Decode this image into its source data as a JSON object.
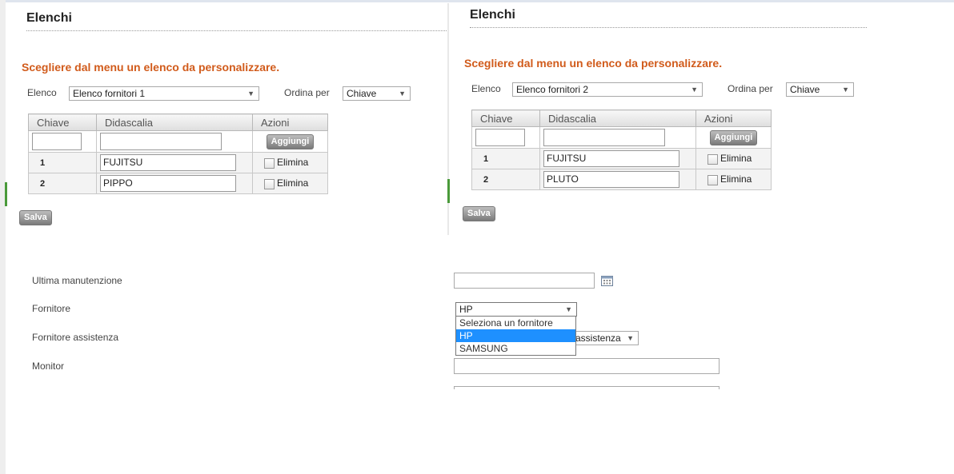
{
  "panel1": {
    "title": "Elenchi",
    "message": "Scegliere dal menu un elenco da personalizzare.",
    "elenco_label": "Elenco",
    "elenco_value": "Elenco fornitori 1",
    "ordina_label": "Ordina per",
    "ordina_value": "Chiave",
    "columns": [
      "Chiave",
      "Didascalia",
      "Azioni"
    ],
    "add_button": "Aggiungi",
    "rows": [
      {
        "key": "1",
        "caption": "FUJITSU",
        "action": "Elimina"
      },
      {
        "key": "2",
        "caption": "PIPPO",
        "action": "Elimina"
      }
    ],
    "save_button": "Salva"
  },
  "panel2": {
    "title": "Elenchi",
    "message": "Scegliere dal menu un elenco da personalizzare.",
    "elenco_label": "Elenco",
    "elenco_value": "Elenco fornitori 2",
    "ordina_label": "Ordina per",
    "ordina_value": "Chiave",
    "columns": [
      "Chiave",
      "Didascalia",
      "Azioni"
    ],
    "add_button": "Aggiungi",
    "rows": [
      {
        "key": "1",
        "caption": "FUJITSU",
        "action": "Elimina"
      },
      {
        "key": "2",
        "caption": "PLUTO",
        "action": "Elimina"
      }
    ],
    "save_button": "Salva"
  },
  "form": {
    "ultima_label": "Ultima manutenzione",
    "fornitore_label": "Fornitore",
    "fornitore_value": "HP",
    "fornitore_options": [
      "Seleziona un fornitore",
      "HP",
      "SAMSUNG"
    ],
    "assistenza_label": "Fornitore assistenza",
    "assistenza_value": "assistenza",
    "monitor_label": "Monitor"
  },
  "icons": {
    "calendar": "calendar-icon",
    "dropdown": "chevron-down-icon"
  },
  "colors": {
    "accent": "#d15b1b",
    "selected": "#1e90ff"
  }
}
